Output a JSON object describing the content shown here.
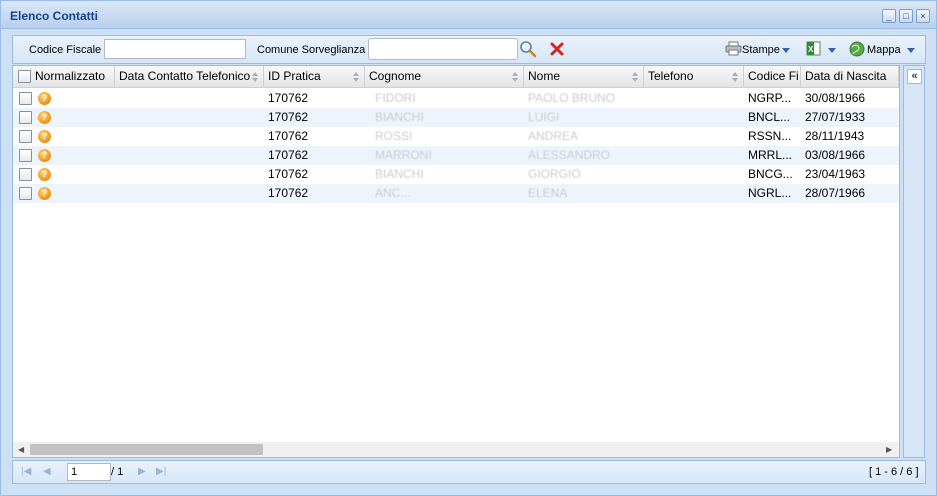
{
  "window": {
    "title": "Elenco Contatti",
    "tools": [
      "_",
      "□",
      "×"
    ]
  },
  "toolbar": {
    "codice_fiscale_label": "Codice Fiscale",
    "codice_fiscale_value": "",
    "comune_label": "Comune Sorveglianza",
    "comune_value": "",
    "stampe_label": "Stampe",
    "mappa_label": "Mappa"
  },
  "grid": {
    "columns": [
      "Normalizzato",
      "Data Contatto Telefonico",
      "ID Pratica",
      "Cognome",
      "Nome",
      "Telefono",
      "Codice Fi",
      "Data di Nascita"
    ],
    "rows": [
      {
        "data_contatto": "",
        "id_pratica": "170762",
        "cognome": "FIDORI",
        "nome": "PAOLO BRUNO",
        "telefono": "",
        "codice_fiscale": "NGRP...",
        "data_nascita": "30/08/1966"
      },
      {
        "data_contatto": "",
        "id_pratica": "170762",
        "cognome": "BIANCHI",
        "nome": "LUIGI",
        "telefono": "",
        "codice_fiscale": "BNCL...",
        "data_nascita": "27/07/1933"
      },
      {
        "data_contatto": "",
        "id_pratica": "170762",
        "cognome": "ROSSI",
        "nome": "ANDREA",
        "telefono": "",
        "codice_fiscale": "RSSN...",
        "data_nascita": "28/11/1943"
      },
      {
        "data_contatto": "",
        "id_pratica": "170762",
        "cognome": "MARRONI",
        "nome": "ALESSANDRO",
        "telefono": "",
        "codice_fiscale": "MRRL...",
        "data_nascita": "03/08/1966"
      },
      {
        "data_contatto": "",
        "id_pratica": "170762",
        "cognome": "BIANCHI",
        "nome": "GIORGIO",
        "telefono": "",
        "codice_fiscale": "BNCG...",
        "data_nascita": "23/04/1963"
      },
      {
        "data_contatto": "",
        "id_pratica": "170762",
        "cognome": "ANC...",
        "nome": "ELENA",
        "telefono": "",
        "codice_fiscale": "NGRL...",
        "data_nascita": "28/07/1966"
      }
    ]
  },
  "pager": {
    "page_value": "1",
    "page_total": "/ 1",
    "range": "[ 1 - 6 / 6 ]"
  },
  "colors": {
    "accent": "#99bbe8",
    "title_text": "#15428b",
    "row_alt": "#eef4fc",
    "clear_icon": "#d0261f",
    "status_icon": "#f39a1c"
  },
  "icons": {
    "search": "search-icon",
    "clear": "clear-icon",
    "print": "printer-icon",
    "export": "excel-icon",
    "map": "globe-icon",
    "status": "question-icon"
  }
}
